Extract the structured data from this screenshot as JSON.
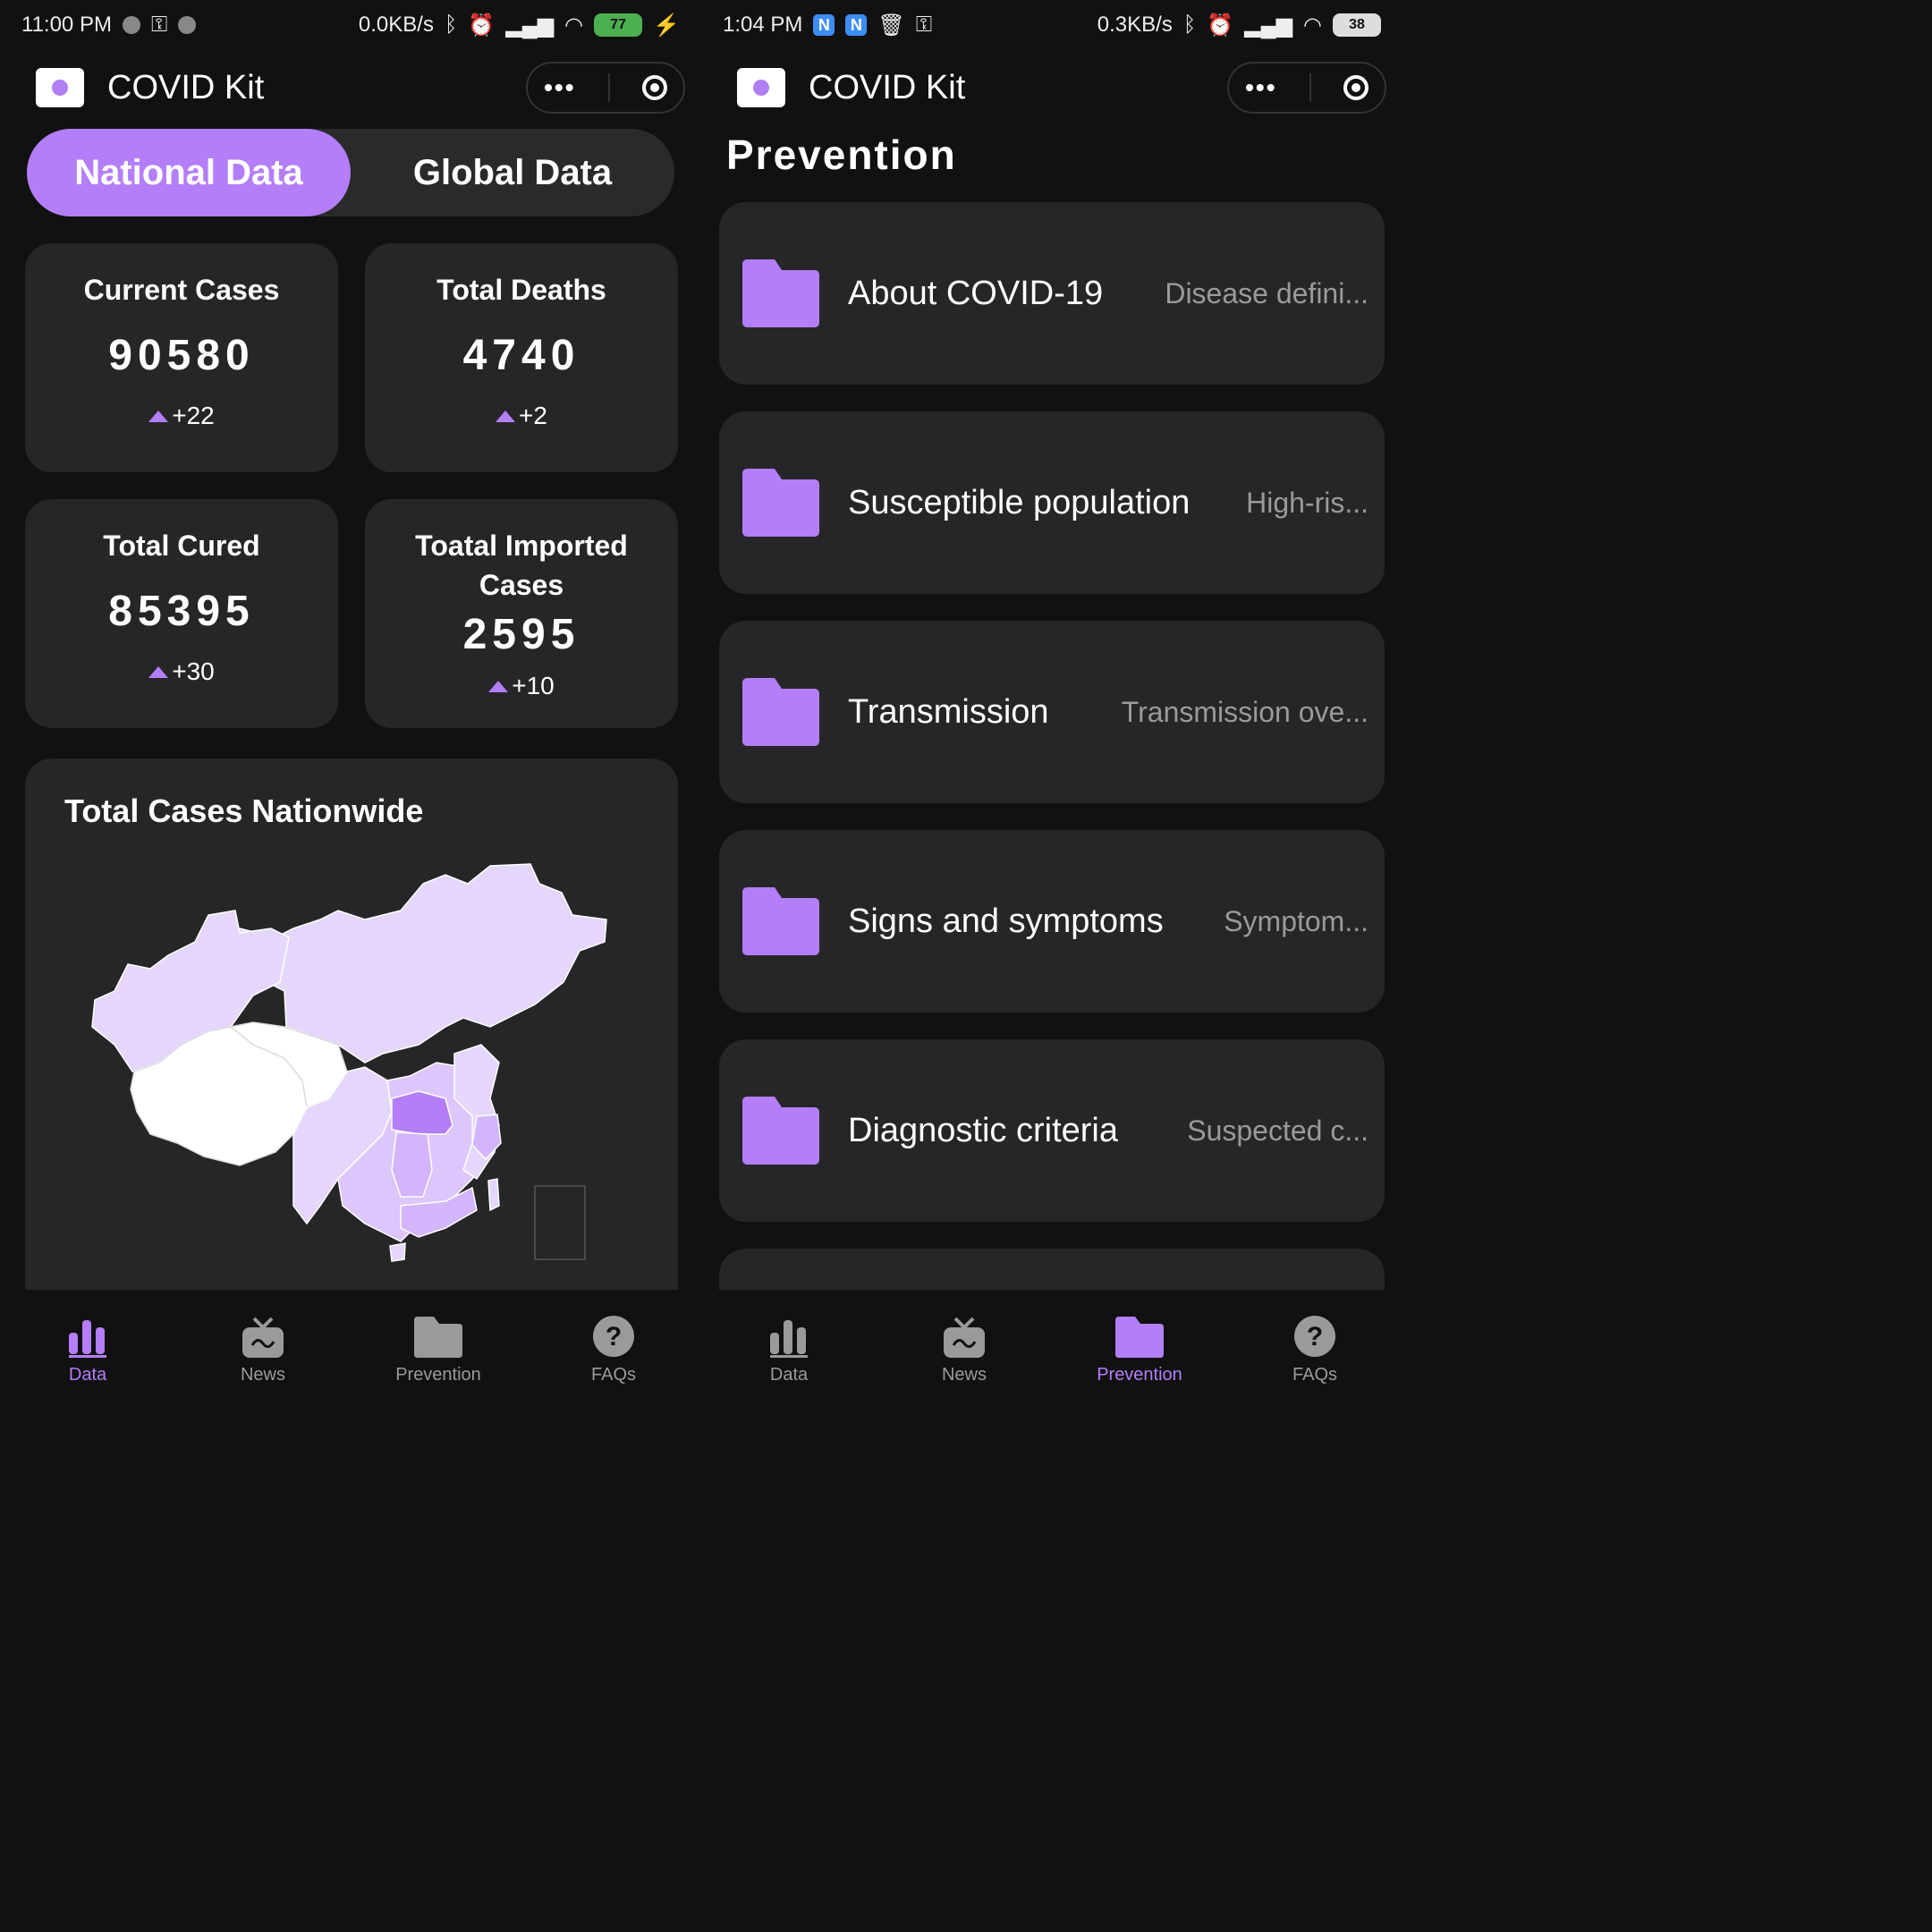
{
  "left": {
    "status": {
      "time": "11:00 PM",
      "speed": "0.0KB/s",
      "battery": "77"
    },
    "app_title": "COVID Kit",
    "capsule_more": "•••",
    "segments": [
      "National Data",
      "Global Data"
    ],
    "stats": [
      {
        "label": "Current Cases",
        "value": "90580",
        "delta": "+22"
      },
      {
        "label": "Total Deaths",
        "value": "4740",
        "delta": "+2"
      },
      {
        "label": "Total Cured",
        "value": "85395",
        "delta": "+30"
      },
      {
        "label": "Toatal Imported Cases",
        "value": "2595",
        "delta": "+10"
      }
    ],
    "map_title": "Total Cases Nationwide",
    "tabs": [
      {
        "label": "Data",
        "icon": "bar-chart-icon"
      },
      {
        "label": "News",
        "icon": "tv-icon"
      },
      {
        "label": "Prevention",
        "icon": "folder-icon"
      },
      {
        "label": "FAQs",
        "icon": "question-icon"
      }
    ],
    "active_tab": "Data"
  },
  "right": {
    "status": {
      "time": "1:04 PM",
      "badge1": "N",
      "badge2": "N",
      "speed": "0.3KB/s",
      "battery": "38"
    },
    "app_title": "COVID Kit",
    "capsule_more": "•••",
    "heading": "Prevention",
    "items": [
      {
        "title": "About COVID-19",
        "subtitle": "Disease defini..."
      },
      {
        "title": "Susceptible population",
        "subtitle": "High-ris..."
      },
      {
        "title": "Transmission",
        "subtitle": "Transmission ove..."
      },
      {
        "title": "Signs and symptoms",
        "subtitle": "Symptom..."
      },
      {
        "title": "Diagnostic criteria",
        "subtitle": "Suspected c..."
      }
    ],
    "tabs": [
      {
        "label": "Data",
        "icon": "bar-chart-icon"
      },
      {
        "label": "News",
        "icon": "tv-icon"
      },
      {
        "label": "Prevention",
        "icon": "folder-icon"
      },
      {
        "label": "FAQs",
        "icon": "question-icon"
      }
    ],
    "active_tab": "Prevention"
  },
  "colors": {
    "accent": "#b47ef8",
    "card": "#262628",
    "background": "#111111",
    "inactive": "#9a9a9a"
  }
}
